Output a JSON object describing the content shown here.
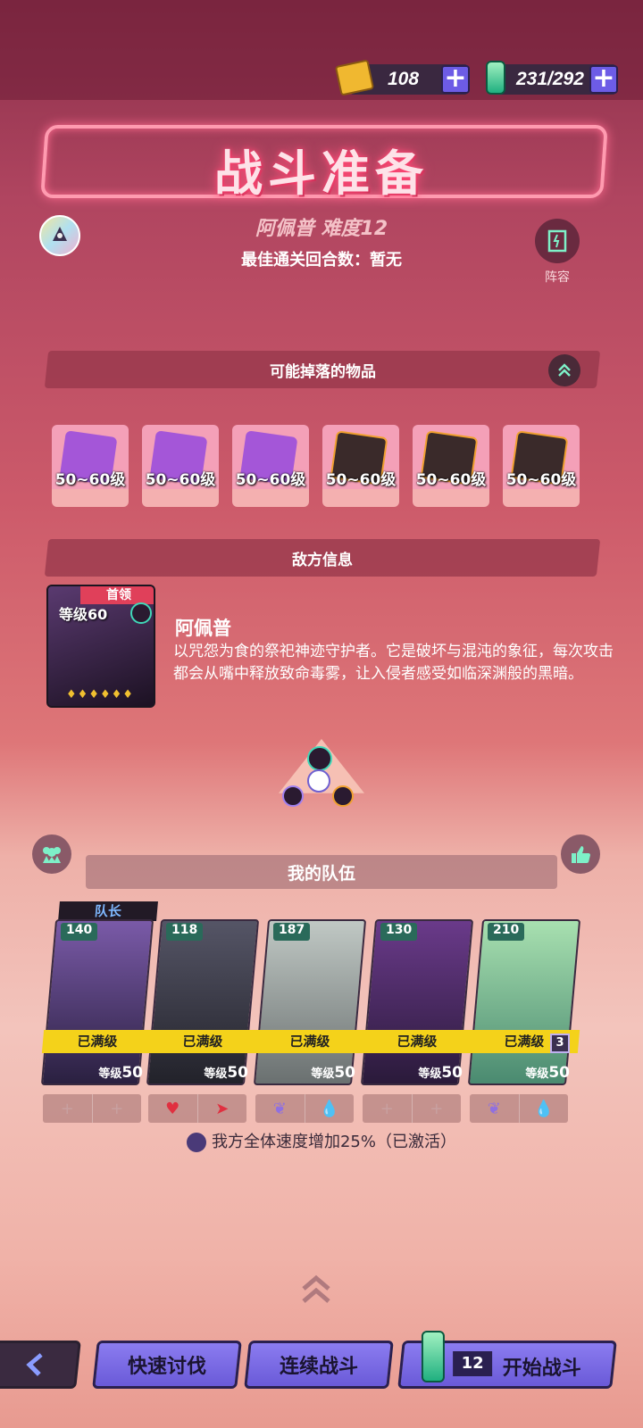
{
  "currency": {
    "tickets": "108",
    "energy": "231/292"
  },
  "header": {
    "title": "战斗准备",
    "subtitle": "阿佩普 难度12",
    "best_rounds": "最佳通关回合数：暂无",
    "formation_label": "阵容"
  },
  "drops": {
    "title": "可能掉落的物品",
    "items": [
      {
        "level": "50~60级",
        "icon": "purple-cube-wing-icon",
        "color": "#a456d8"
      },
      {
        "level": "50~60级",
        "icon": "purple-cube-cross-icon",
        "color": "#a456d8"
      },
      {
        "level": "50~60级",
        "icon": "purple-cube-eye-icon",
        "color": "#a456d8"
      },
      {
        "level": "50~60级",
        "icon": "dark-cube-plus-icon",
        "color": "#3a2a2a"
      },
      {
        "level": "50~60级",
        "icon": "dark-cube-moon-icon",
        "color": "#3a2a2a"
      },
      {
        "level": "50~60级",
        "icon": "dark-cube-arrow-icon",
        "color": "#3a2a2a"
      }
    ]
  },
  "enemy": {
    "section_title": "敌方信息",
    "boss_tag": "首领",
    "level": "等级60",
    "name": "阿佩普",
    "description": "以咒怨为食的祭祀神迹守护者。它是破坏与混沌的象征，每次攻击都会从嘴中释放致命毒雾，让入侵者感受如临深渊般的黑暗。"
  },
  "team": {
    "title": "我的队伍",
    "leader_tag": "队长",
    "heroes": [
      {
        "power": "140",
        "status": "已满级",
        "level_label": "等级",
        "level": "50",
        "bg": "#7a5aa8"
      },
      {
        "power": "118",
        "status": "已满级",
        "level_label": "等级",
        "level": "50",
        "bg": "#555566"
      },
      {
        "power": "187",
        "status": "已满级",
        "level_label": "等级",
        "level": "50",
        "bg": "#9aa0a0"
      },
      {
        "power": "130",
        "status": "已满级",
        "level_label": "等级",
        "level": "50",
        "bg": "#6a3a8a"
      },
      {
        "power": "210",
        "status": "已满级",
        "level_label": "等级",
        "level": "50",
        "bg": "#8ac890"
      }
    ],
    "badge_count": "3",
    "buff": "我方全体速度增加25%（已激活）"
  },
  "actions": {
    "quick": "快速讨伐",
    "continuous": "连续战斗",
    "energy_cost": "12",
    "start": "开始战斗"
  }
}
